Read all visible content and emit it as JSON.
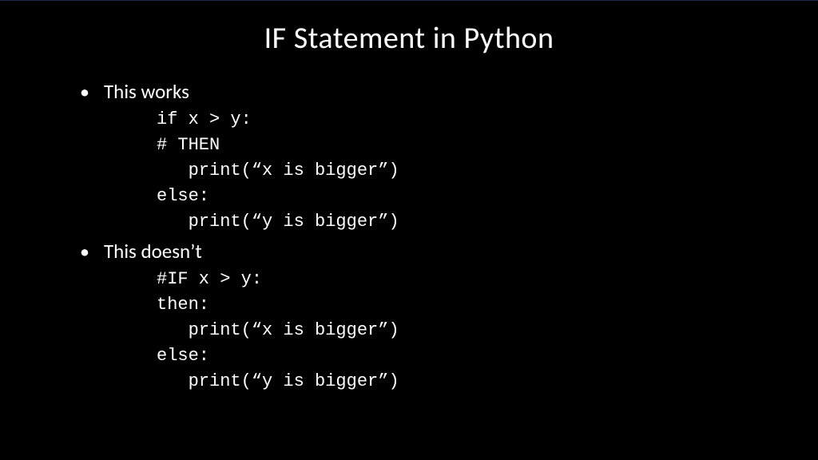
{
  "slide": {
    "title": "IF Statement in Python",
    "bullets": [
      {
        "label": "This works",
        "code": "if x > y:\n# THEN\n   print(“x is bigger”)\nelse:\n   print(“y is bigger”)"
      },
      {
        "label": "This doesn’t",
        "code": "#IF x > y:\nthen:\n   print(“x is bigger”)\nelse:\n   print(“y is bigger”)"
      }
    ]
  }
}
